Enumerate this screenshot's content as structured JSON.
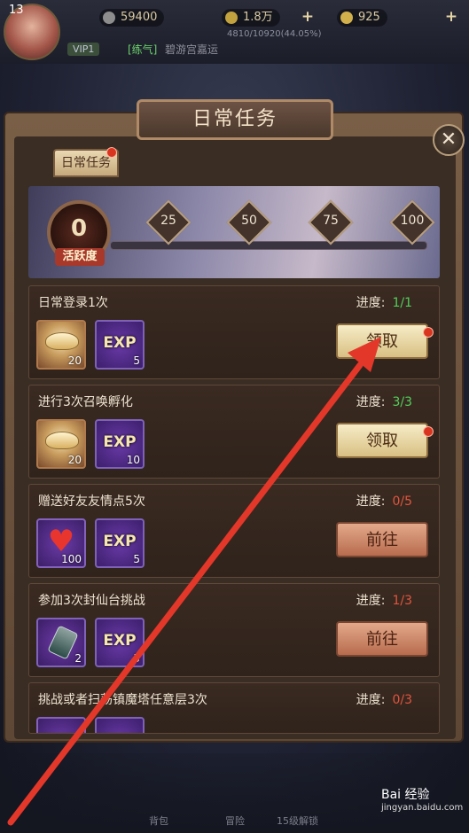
{
  "topbar": {
    "level": "13",
    "currency1": "59400",
    "currency2": "1.8万",
    "currency3": "925",
    "exp_text": "4810/10920(44.05%)",
    "vip": "VIP1",
    "guild_tag": "[练气]",
    "guild_name": "碧游宫嘉运"
  },
  "panel": {
    "title": "日常任务",
    "tab_label": "日常任务",
    "close_icon": "close-icon"
  },
  "activity": {
    "value": "0",
    "label": "活跃度",
    "milestones": [
      "25",
      "50",
      "75",
      "100"
    ]
  },
  "tasks": [
    {
      "name": "日常登录1次",
      "progress_label": "进度:",
      "progress": "1/1",
      "rewards": [
        {
          "icon": "gold-ingot-icon",
          "qty": "20"
        },
        {
          "icon": "exp-icon",
          "qty": "5",
          "glyph": "EXP"
        }
      ],
      "button": "领取"
    },
    {
      "name": "进行3次召唤孵化",
      "progress_label": "进度:",
      "progress": "3/3",
      "rewards": [
        {
          "icon": "gold-ingot-icon",
          "qty": "20"
        },
        {
          "icon": "exp-icon",
          "qty": "10",
          "glyph": "EXP"
        }
      ],
      "button": "领取"
    },
    {
      "name": "赠送好友友情点5次",
      "progress_label": "进度:",
      "progress": "0/5",
      "rewards": [
        {
          "icon": "heart-icon",
          "qty": "100"
        },
        {
          "icon": "exp-icon",
          "qty": "5",
          "glyph": "EXP"
        }
      ],
      "button": "前往"
    },
    {
      "name": "参加3次封仙台挑战",
      "progress_label": "进度:",
      "progress": "1/3",
      "rewards": [
        {
          "icon": "armor-icon",
          "qty": "2"
        },
        {
          "icon": "exp-icon",
          "qty": "5",
          "glyph": "EXP"
        }
      ],
      "button": "前往"
    },
    {
      "name": "挑战或者扫荡镇魔塔任意层3次",
      "progress_label": "进度:",
      "progress": "0/3",
      "rewards": [],
      "button": ""
    }
  ],
  "bottom_nav": [
    "背包",
    "冒险",
    "15级解锁"
  ],
  "watermark": {
    "brand": "Bai 经验",
    "url": "jingyan.baidu.com"
  },
  "colors": {
    "done": "#52d05a",
    "todo": "#e0553e",
    "accent": "#e3372a"
  }
}
